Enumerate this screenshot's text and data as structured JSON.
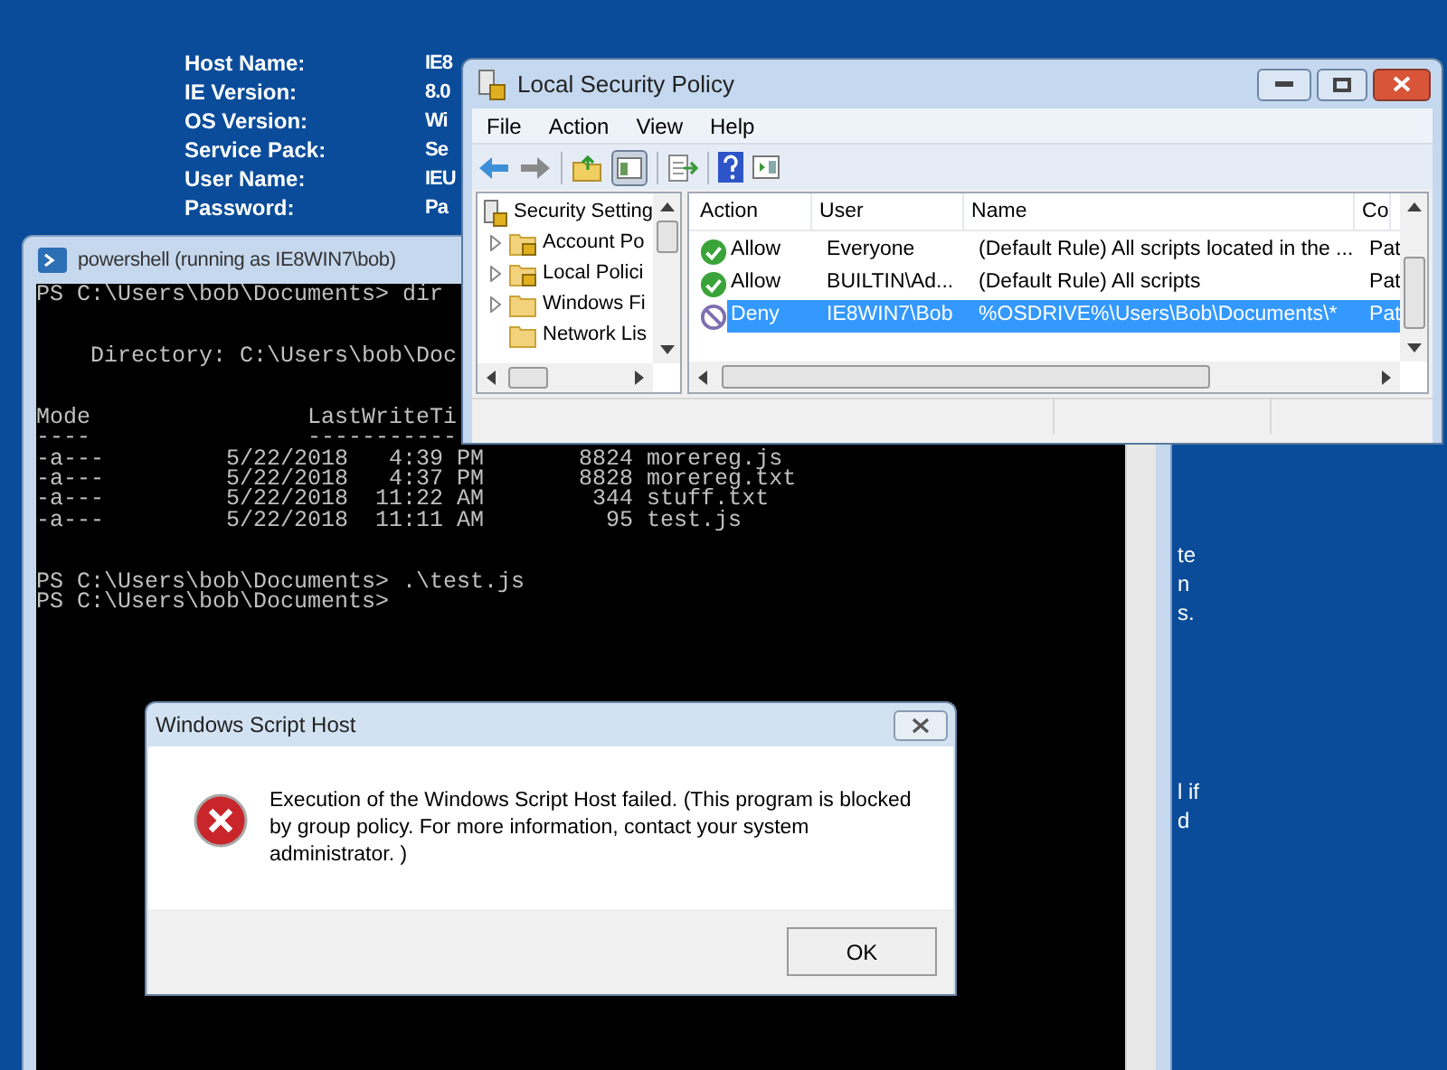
{
  "desktop": {
    "info": [
      {
        "label": "Host Name:",
        "value": "IE8"
      },
      {
        "label": "IE Version:",
        "value": "8.0"
      },
      {
        "label": "OS Version:",
        "value": "Wi"
      },
      {
        "label": "Service Pack:",
        "value": "Se"
      },
      {
        "label": "User Name:",
        "value": "IEU"
      },
      {
        "label": "Password:",
        "value": "Pa"
      }
    ],
    "fragments": [
      "te",
      "n",
      "s.",
      "l if",
      "d"
    ]
  },
  "powershell": {
    "title": "powershell (running as IE8WIN7\\bob)",
    "blocks": [
      [
        "PS C:\\Users\\bob\\Documents> dir"
      ],
      [
        "    Directory: C:\\Users\\bob\\Doc"
      ],
      [
        "Mode                LastWriteTi",
        "----                -----------",
        "-a---         5/22/2018   4:39 PM       8824 morereg.js",
        "-a---         5/22/2018   4:37 PM       8828 morereg.txt",
        "-a---         5/22/2018  11:22 AM        344 stuff.txt",
        "-a---         5/22/2018  11:11 AM         95 test.js"
      ],
      [
        "PS C:\\Users\\bob\\Documents> .\\test.js",
        "PS C:\\Users\\bob\\Documents>"
      ]
    ]
  },
  "lsp": {
    "title": "Local Security Policy",
    "menu": [
      "File",
      "Action",
      "View",
      "Help"
    ],
    "tree": {
      "label": "Security Setting",
      "children": [
        {
          "label": "Account Po",
          "kind": "policy",
          "expandable": true
        },
        {
          "label": "Local Polici",
          "kind": "policy",
          "expandable": true
        },
        {
          "label": "Windows Fi",
          "kind": "folder",
          "expandable": true
        },
        {
          "label": "Network Lis",
          "kind": "folder",
          "expandable": false
        }
      ]
    },
    "columns": [
      "Action",
      "User",
      "Name",
      "Co"
    ],
    "rows": [
      {
        "kind": "allow",
        "action": "Allow",
        "user": "Everyone",
        "name": "(Default Rule) All scripts located in the ...",
        "column_4": "Pat",
        "selected": false
      },
      {
        "kind": "allow",
        "action": "Allow",
        "user": "BUILTIN\\Ad...",
        "name": "(Default Rule) All scripts",
        "column_4": "Pat",
        "selected": false
      },
      {
        "kind": "deny",
        "action": "Deny",
        "user": "IE8WIN7\\Bob",
        "name": "%OSDRIVE%\\Users\\Bob\\Documents\\*",
        "column_4": "Pat",
        "selected": true
      }
    ]
  },
  "dialog": {
    "title": "Windows Script Host",
    "message": "Execution of the Windows Script Host failed. (This program is blocked by group policy. For more information, contact your system administrator. )",
    "button": "OK"
  }
}
